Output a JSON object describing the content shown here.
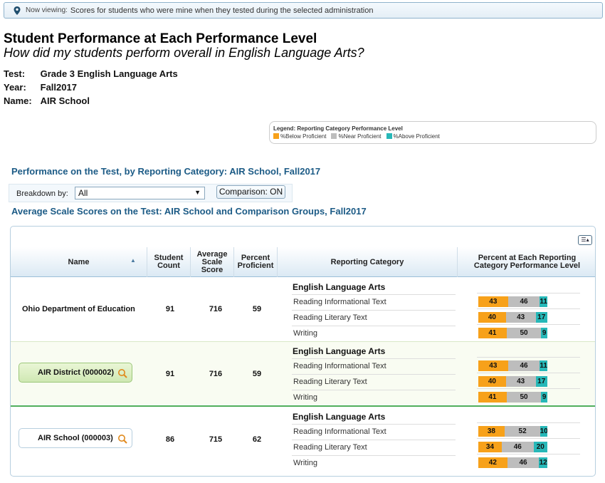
{
  "banner": {
    "prefix": "Now viewing:",
    "message": "Scores for students who were mine when they tested during the selected administration"
  },
  "header": {
    "title": "Student Performance at Each Performance Level",
    "subtitle": "How did my students perform overall in English Language Arts?"
  },
  "meta": {
    "test_label": "Test:",
    "test_value": "Grade 3 English Language Arts",
    "year_label": "Year:",
    "year_value": "Fall2017",
    "name_label": "Name:",
    "name_value": "AIR School"
  },
  "legend": {
    "title": "Legend: Reporting Category Performance Level",
    "items": [
      "%Below Proficient",
      "%Near Proficient",
      "%Above Proficient"
    ],
    "colors": [
      "#f7a11a",
      "#bdbdbd",
      "#27b8b8"
    ]
  },
  "section1_title": "Performance on the Test, by Reporting Category: AIR School, Fall2017",
  "breakdown": {
    "label": "Breakdown by:",
    "value": "All"
  },
  "comparison_button": "Comparison: ON",
  "section2_title": "Average Scale Scores on the Test: AIR School and Comparison Groups, Fall2017",
  "table": {
    "headers": {
      "name": "Name",
      "count": "Student Count",
      "avg": "Average Scale Score",
      "pct": "Percent Proficient",
      "category": "Reporting Category",
      "levels": "Percent at Each Reporting Category Performance Level"
    },
    "rows": [
      {
        "name": "Ohio Department of Education",
        "count": "91",
        "avg": "716",
        "pct": "59",
        "category_title": "English Language Arts",
        "categories": [
          {
            "label": "Reading Informational Text",
            "below": 43,
            "near": 46,
            "above": 11
          },
          {
            "label": "Reading Literary Text",
            "below": 40,
            "near": 43,
            "above": 17
          },
          {
            "label": "Writing",
            "below": 41,
            "near": 50,
            "above": 9
          }
        ]
      },
      {
        "name": "AIR District (000002)",
        "count": "91",
        "avg": "716",
        "pct": "59",
        "category_title": "English Language Arts",
        "categories": [
          {
            "label": "Reading Informational Text",
            "below": 43,
            "near": 46,
            "above": 11
          },
          {
            "label": "Reading Literary Text",
            "below": 40,
            "near": 43,
            "above": 17
          },
          {
            "label": "Writing",
            "below": 41,
            "near": 50,
            "above": 9
          }
        ]
      },
      {
        "name": "AIR School (000003)",
        "count": "86",
        "avg": "715",
        "pct": "62",
        "category_title": "English Language Arts",
        "categories": [
          {
            "label": "Reading Informational Text",
            "below": 38,
            "near": 52,
            "above": 10
          },
          {
            "label": "Reading Literary Text",
            "below": 34,
            "near": 46,
            "above": 20
          },
          {
            "label": "Writing",
            "below": 42,
            "near": 46,
            "above": 12
          }
        ]
      }
    ]
  }
}
